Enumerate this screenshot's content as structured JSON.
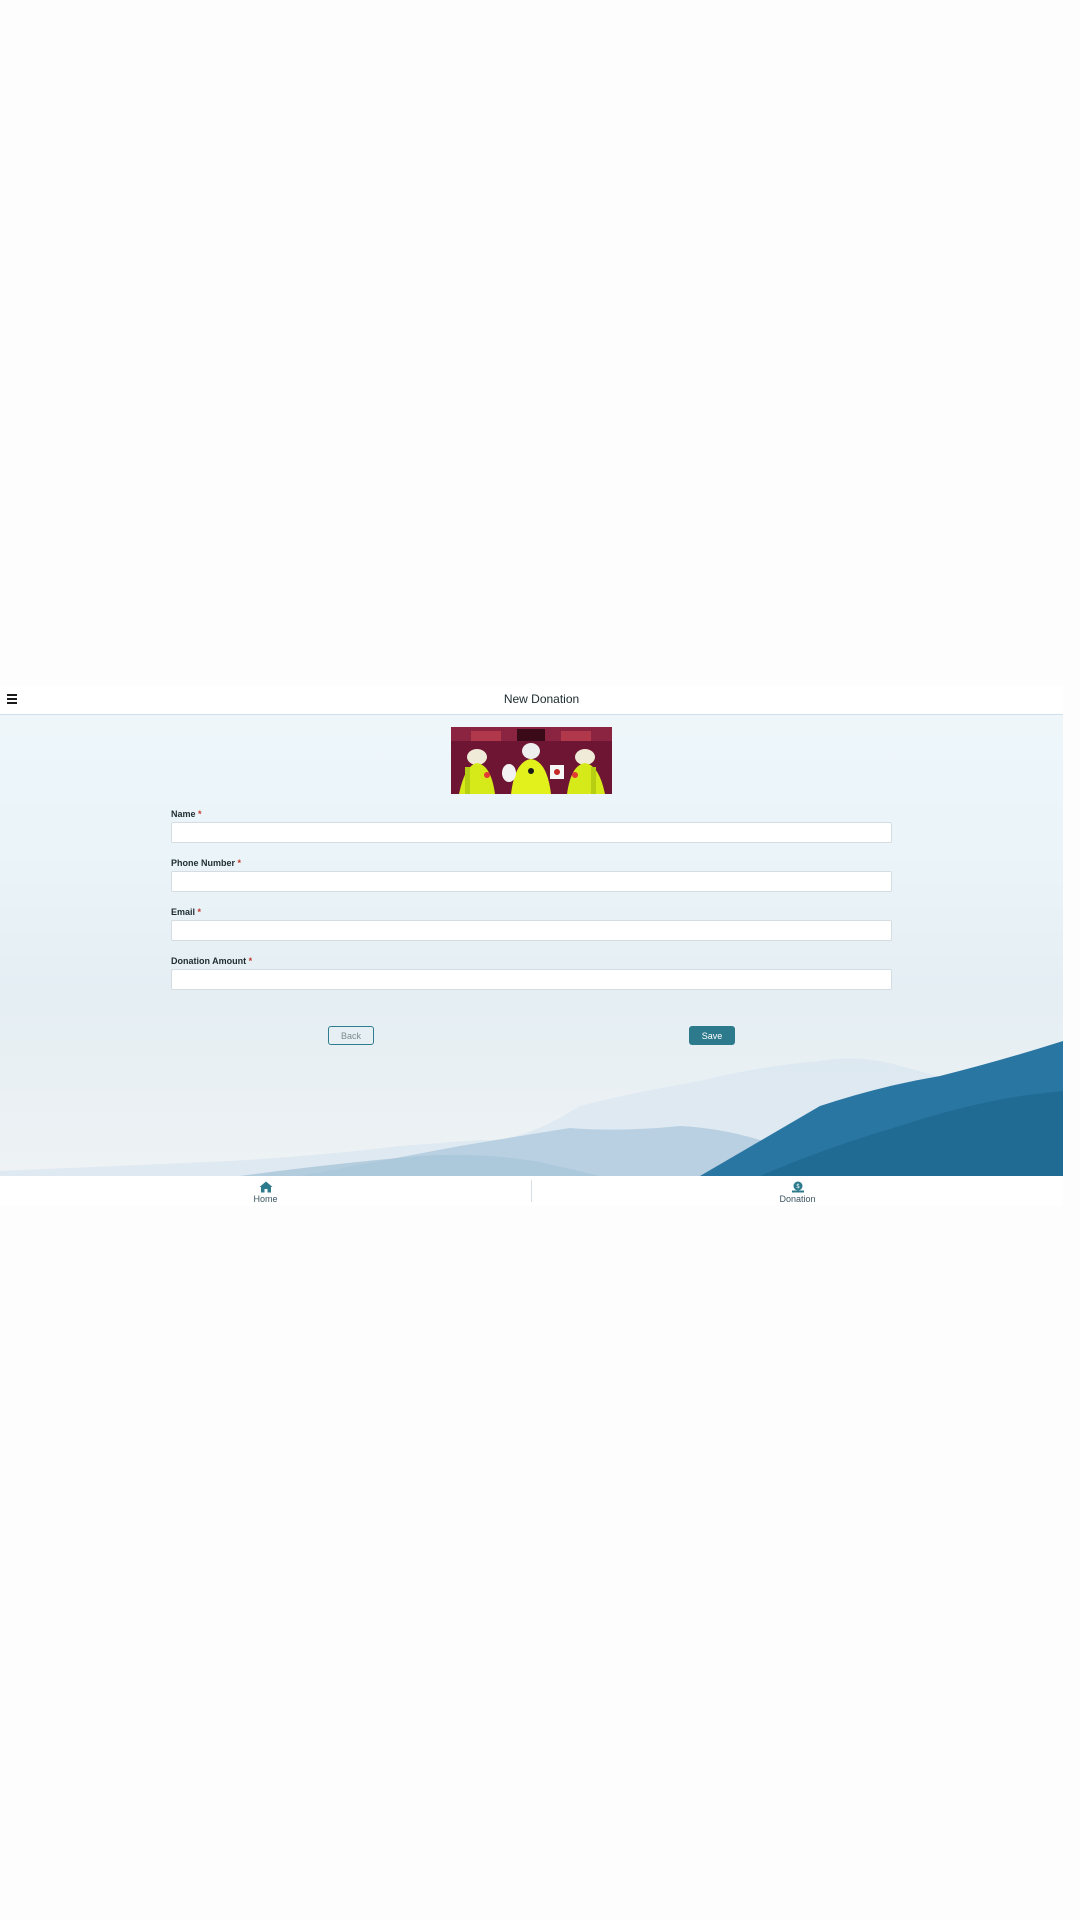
{
  "header": {
    "title": "New Donation",
    "menu_icon": "hamburger-menu-icon"
  },
  "form": {
    "fields": [
      {
        "label": "Name",
        "required_mark": "*",
        "value": "",
        "placeholder": ""
      },
      {
        "label": "Phone Number",
        "required_mark": "*",
        "value": "",
        "placeholder": ""
      },
      {
        "label": "Email",
        "required_mark": "*",
        "value": "",
        "placeholder": ""
      },
      {
        "label": "Donation Amount",
        "required_mark": "*",
        "value": "",
        "placeholder": ""
      }
    ],
    "back_label": "Back",
    "save_label": "Save"
  },
  "footer": {
    "items": [
      {
        "label": "Home",
        "icon": "home-icon"
      },
      {
        "label": "Donation",
        "icon": "donation-icon"
      }
    ]
  },
  "colors": {
    "accent": "#2c7a8c",
    "required": "#c0392b",
    "mountain_dark": "#1f6b94",
    "mountain_light": "#b3cfe2"
  }
}
